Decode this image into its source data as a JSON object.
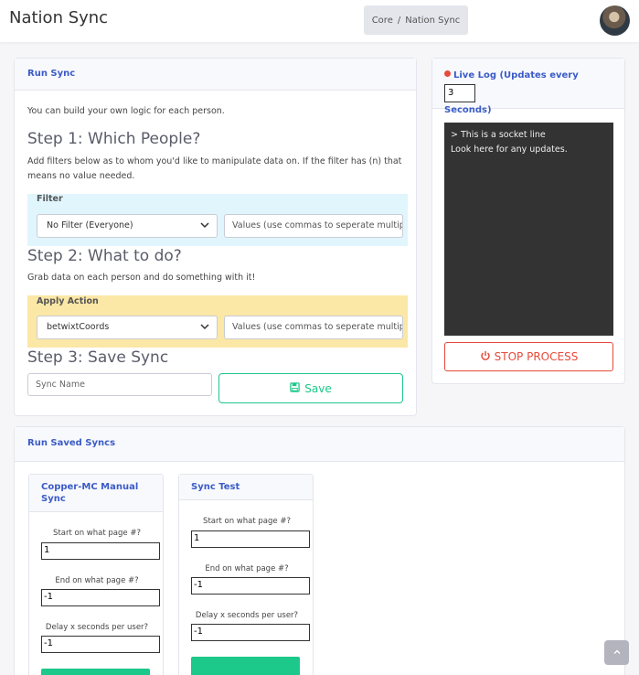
{
  "app": {
    "title": "Nation Sync"
  },
  "breadcrumb": {
    "root": "Core",
    "separator": "/",
    "current": "Nation Sync"
  },
  "run_sync": {
    "header": "Run Sync",
    "intro": "You can build your own logic for each person.",
    "step1": {
      "title": "Step 1: Which People?",
      "desc": "Add filters below as to whom you'd like to manipulate data on. If the filter has (n) that means no value needed.",
      "box_label": "Filter",
      "select_value": "No Filter (Everyone)",
      "values_placeholder": "Values (use commas to seperate multiple)"
    },
    "step2": {
      "title": "Step 2: What to do?",
      "desc": "Grab data on each person and do something with it!",
      "box_label": "Apply Action",
      "select_value": "betwixtCoords",
      "values_placeholder": "Values (use commas to seperate multiple)"
    },
    "step3": {
      "title": "Step 3: Save Sync",
      "name_placeholder": "Sync Name",
      "save_label": "Save"
    }
  },
  "live_log": {
    "title_prefix": "Live Log (Updates every",
    "title_suffix": "Seconds)",
    "interval": "3",
    "lines": [
      "> This is a socket line",
      "Look here for any updates."
    ],
    "stop_label": "STOP PROCESS"
  },
  "saved_syncs": {
    "header": "Run Saved Syncs",
    "items": [
      {
        "name": "Copper-MC Manual Sync",
        "start_label": "Start on what page #?",
        "start_value": "1",
        "end_label": "End on what page #?",
        "end_value": "-1",
        "delay_label": "Delay x seconds per user?",
        "delay_value": "-1"
      },
      {
        "name": "Sync Test",
        "start_label": "Start on what page #?",
        "start_value": "1",
        "end_label": "End on what page #?",
        "end_value": "-1",
        "delay_label": "Delay x seconds per user?",
        "delay_value": "-1"
      }
    ]
  },
  "colors": {
    "primary": "#3a5bc7",
    "success": "#1cc88a",
    "danger": "#e74a3b"
  }
}
